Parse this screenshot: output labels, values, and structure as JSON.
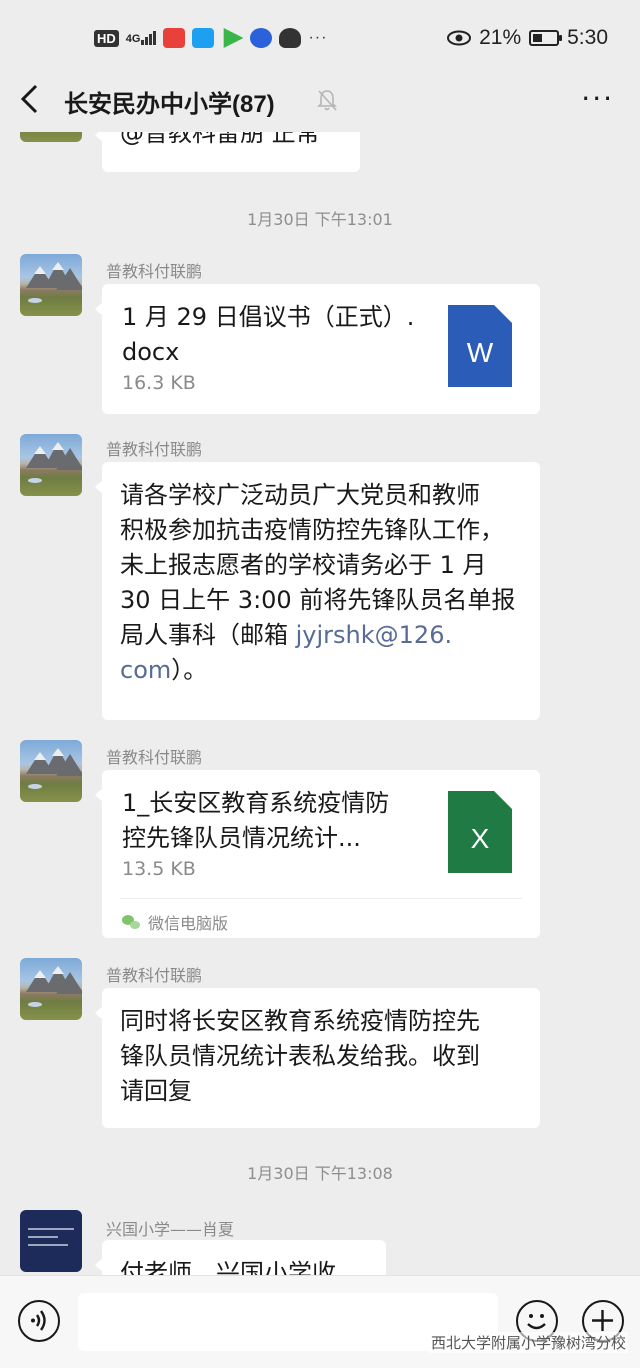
{
  "status_bar": {
    "hd": "HD",
    "network": "4G",
    "more_icons": "···",
    "battery_percent": "21%",
    "time": "5:30",
    "app_colors": [
      "#e8403b",
      "#1ea0f0",
      "#39b54a",
      "#2b62d9"
    ]
  },
  "header": {
    "back_icon": "chevron-left-icon",
    "title": "长安民办中小学(87)",
    "mute_icon": "bell-muted-icon",
    "more_label": "···"
  },
  "messages": {
    "partial_top_text": "@普教科雷朋 正常",
    "ts1": "1月30日 下午13:01",
    "m1_sender": "普教科付联鹏",
    "m1_file_name_1": "1 月 29 日倡议书（正式）.",
    "m1_file_name_2": "docx",
    "m1_file_size": "16.3 KB",
    "m1_file_letter": "W",
    "m2_sender": "普教科付联鹏",
    "m2_lines": [
      "请各学校广泛动员广大党员和教师",
      "积极参加抗击疫情防控先锋队工作，",
      "未上报志愿者的学校请务必于 1 月",
      "30 日上午 3:00 前将先锋队员名单报",
      "局人事科（邮箱 "
    ],
    "m2_email_1": "jyjrshk@126.",
    "m2_email_2": "com",
    "m2_tail": "）。",
    "m3_sender": "普教科付联鹏",
    "m3_file_name_1": "1_长安区教育系统疫情防",
    "m3_file_name_2": "控先锋队员情况统计...",
    "m3_file_size": "13.5 KB",
    "m3_file_letter": "X",
    "m3_source": "微信电脑版",
    "m4_sender": "普教科付联鹏",
    "m4_lines": [
      "同时将长安区教育系统疫情防控先",
      "锋队员情况统计表私发给我。收到",
      "请回复"
    ],
    "ts2": "1月30日 下午13:08",
    "m5_sender": "兴国小学——肖夏",
    "m5_text": "付老师，兴国小学收到。"
  },
  "bottom_bar": {
    "watermark": "西北大学附属小学豫树湾分校"
  },
  "colors": {
    "word": "#2a5cb8",
    "excel": "#1f7a44",
    "link": "#576b95",
    "background": "#ededed"
  }
}
